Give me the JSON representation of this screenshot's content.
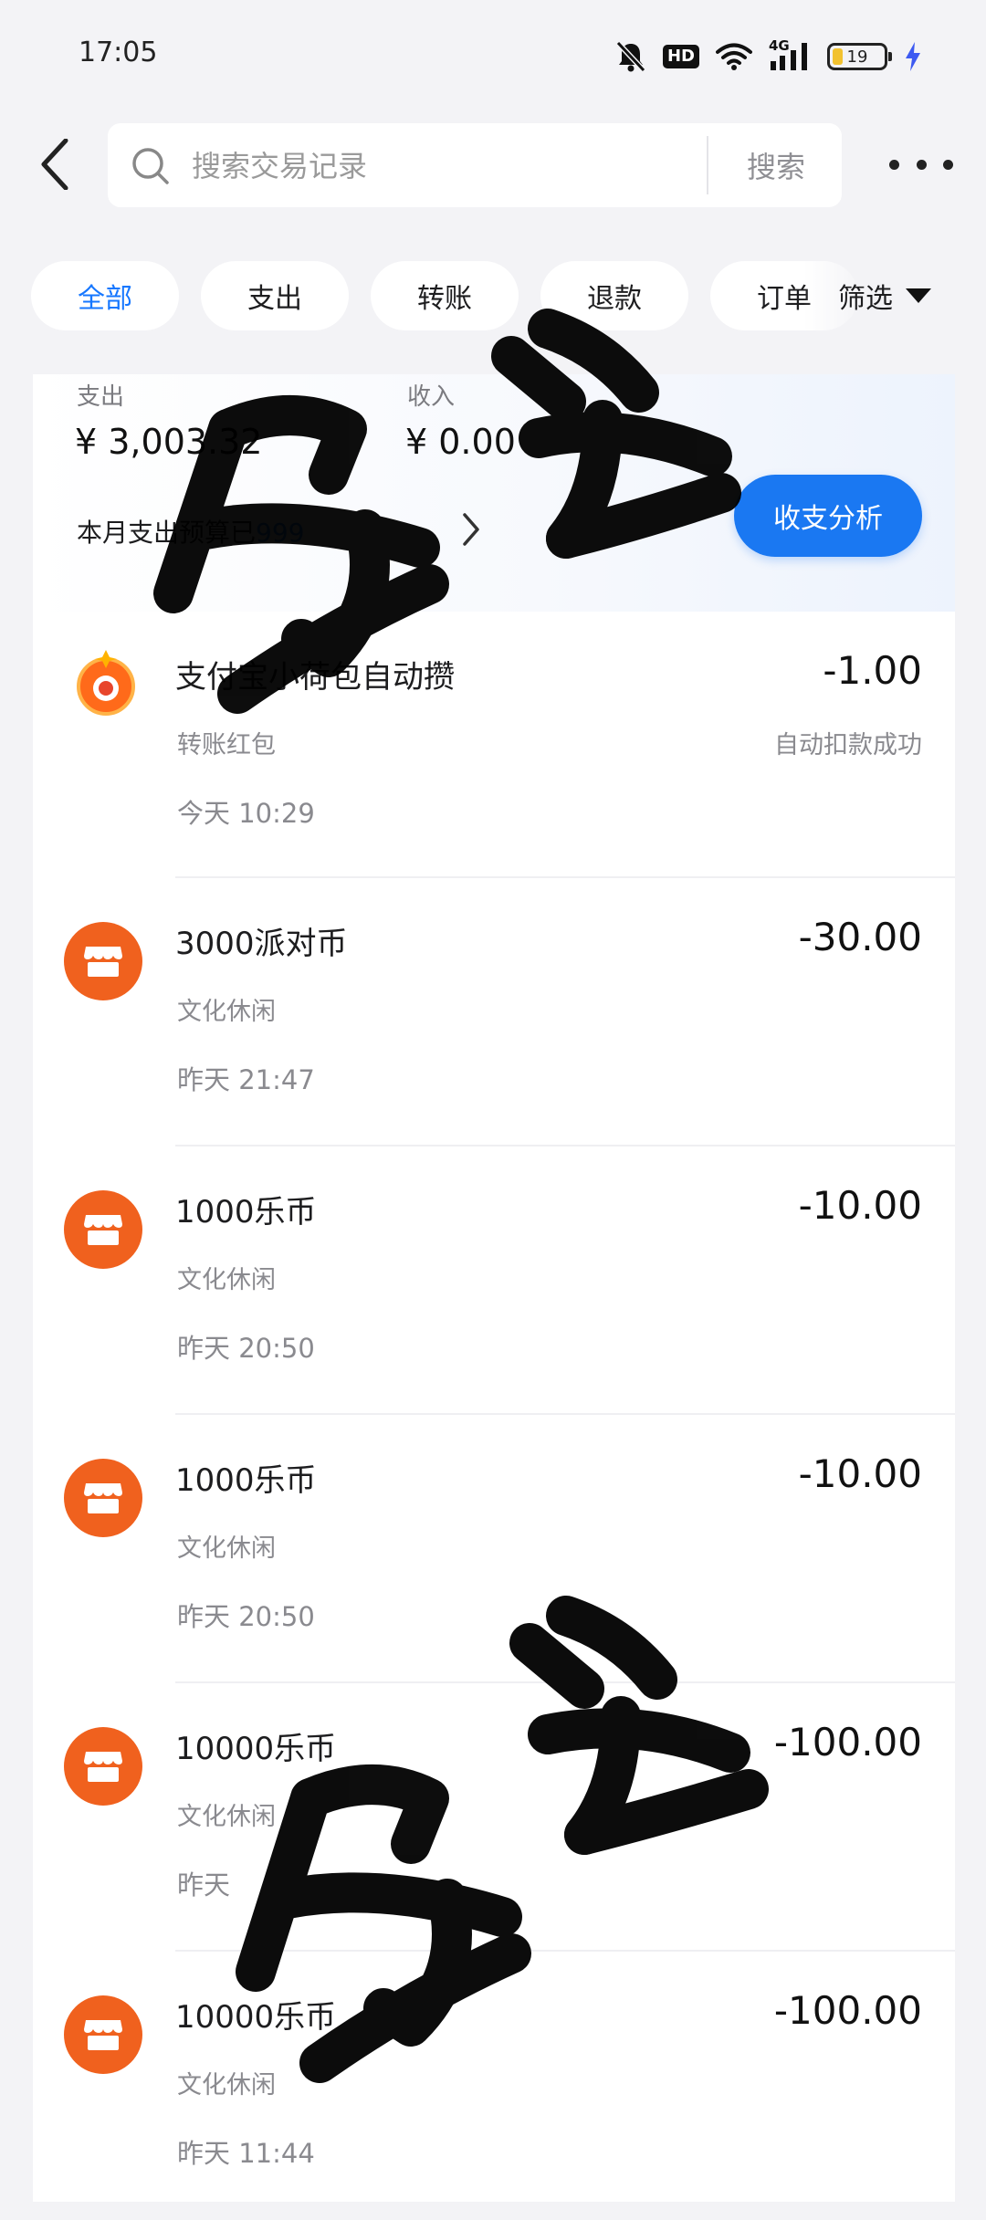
{
  "status_bar": {
    "time": "17:05",
    "hd": "HD",
    "network": "4G",
    "battery": "19"
  },
  "header": {
    "search_placeholder": "搜索交易记录",
    "search_button": "搜索"
  },
  "filters": {
    "tabs": [
      {
        "label": "全部",
        "active": true
      },
      {
        "label": "支出",
        "active": false
      },
      {
        "label": "转账",
        "active": false
      },
      {
        "label": "退款",
        "active": false
      },
      {
        "label": "订单",
        "active": false
      }
    ],
    "select_label": "筛选"
  },
  "summary": {
    "expense_label": "支出",
    "expense_value": "¥ 3,003.32",
    "income_label": "收入",
    "income_value": "¥ 0.00",
    "budget_prefix": "本月支出预算已",
    "budget_amount": "999",
    "analysis_button": "收支分析"
  },
  "transactions": [
    {
      "title": "支付宝小荷包自动攒",
      "category": "转账红包",
      "time": "今天 10:29",
      "amount": "-1.00",
      "status": "自动扣款成功",
      "icon": "yuebao-icon"
    },
    {
      "title": "3000派对币",
      "category": "文化休闲",
      "time": "昨天 21:47",
      "amount": "-30.00",
      "status": "",
      "icon": "shop-icon"
    },
    {
      "title": "1000乐币",
      "category": "文化休闲",
      "time": "昨天 20:50",
      "amount": "-10.00",
      "status": "",
      "icon": "shop-icon"
    },
    {
      "title": "1000乐币",
      "category": "文化休闲",
      "time": "昨天 20:50",
      "amount": "-10.00",
      "status": "",
      "icon": "shop-icon"
    },
    {
      "title": "10000乐币",
      "category": "文化休闲",
      "time": "昨天",
      "amount": "-100.00",
      "status": "",
      "icon": "shop-icon"
    },
    {
      "title": "10000乐币",
      "category": "文化休闲",
      "time": "昨天 11:44",
      "amount": "-100.00",
      "status": "",
      "icon": "shop-icon"
    }
  ],
  "colors": {
    "accent": "#1677ff",
    "shop_icon_bg": "#f0611e",
    "page_bg": "#f3f3f6"
  }
}
